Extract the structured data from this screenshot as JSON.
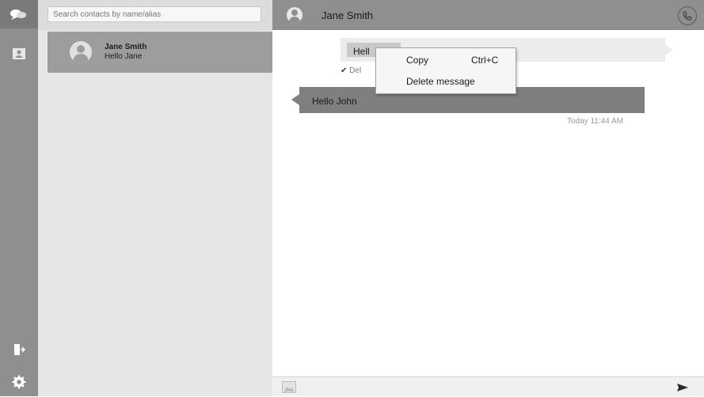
{
  "sidebar": {
    "icons": {
      "top": "chat-bubbles-icon",
      "contacts": "contact-card-icon",
      "logout": "logout-icon",
      "settings": "gear-icon"
    }
  },
  "contacts_panel": {
    "search_placeholder": "Search contacts by name/alias",
    "items": [
      {
        "name": "Jane Smith",
        "last_message": "Hello Jane"
      }
    ]
  },
  "chat": {
    "header_name": "Jane Smith",
    "call_icon": "phone-icon",
    "messages": [
      {
        "direction": "outgoing",
        "text": "Hell",
        "status": "Del"
      },
      {
        "direction": "incoming",
        "text": "Hello John",
        "time": "Today 11:44 AM"
      }
    ]
  },
  "context_menu": {
    "items": [
      {
        "label": "Copy",
        "shortcut": "Ctrl+C"
      },
      {
        "label": "Delete message",
        "shortcut": ""
      }
    ]
  },
  "composer": {
    "image_icon": "image-icon",
    "send_icon": "send-icon"
  },
  "colors": {
    "rail": "#8f8f8f",
    "contact_bg": "#e6e6e6",
    "selected_contact": "#9d9d9d",
    "incoming_bubble": "#7f7f7f",
    "outgoing_bubble": "#ececec"
  }
}
